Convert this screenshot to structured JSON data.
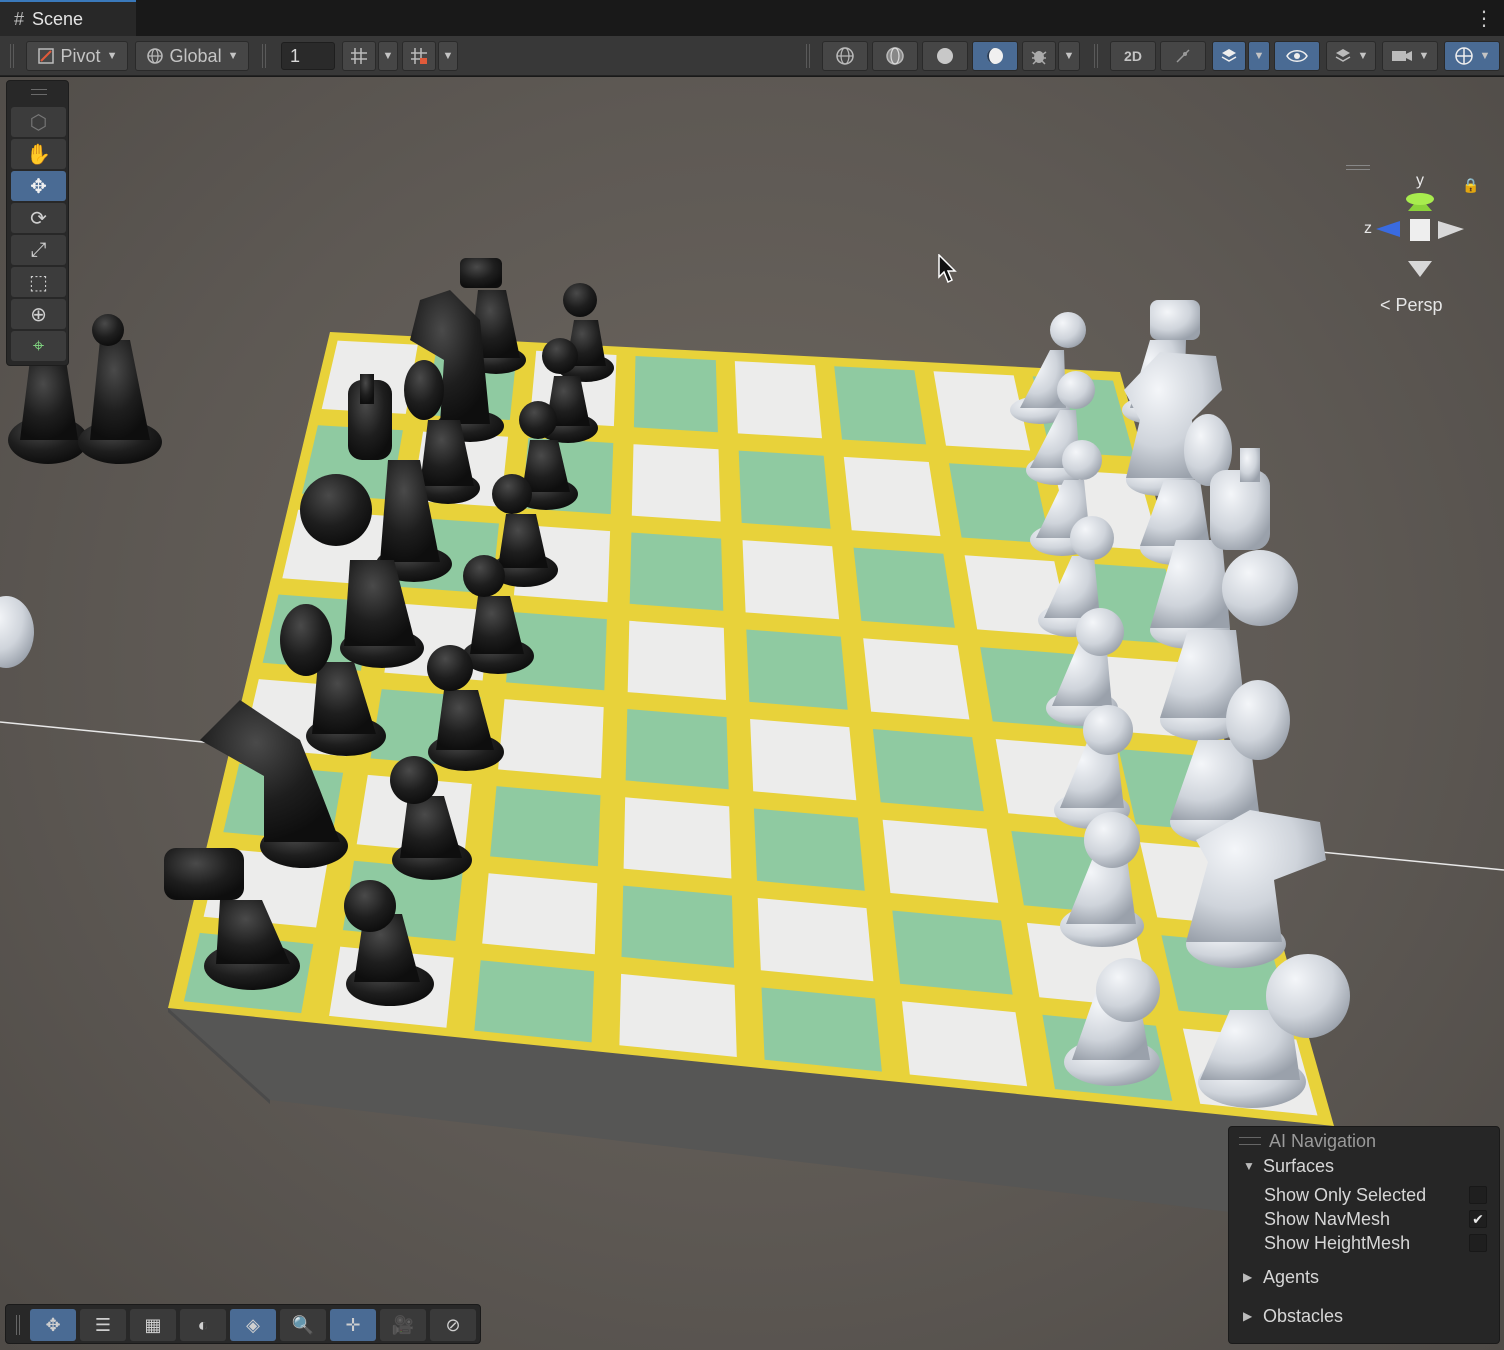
{
  "tab": {
    "icon": "scene-hash-icon",
    "title": "Scene",
    "menu": "⋮"
  },
  "toolbar": {
    "pivot_label": "Pivot",
    "global_label": "Global",
    "grid_value": "1"
  },
  "gizmo": {
    "y": "y",
    "z": "z",
    "persp_label": "Persp"
  },
  "tools": [
    "view-cube-icon",
    "hand-icon",
    "move-icon",
    "rotate-icon",
    "scale-icon",
    "rect-icon",
    "transform-icon",
    "custom-tool-icon"
  ],
  "overlay": {
    "title": "AI Navigation",
    "surfaces_label": "Surfaces",
    "items": [
      {
        "label": "Show Only Selected",
        "checked": false
      },
      {
        "label": "Show NavMesh",
        "checked": true
      },
      {
        "label": "Show HeightMesh",
        "checked": false
      }
    ],
    "agents_label": "Agents",
    "obstacles_label": "Obstacles"
  },
  "colors": {
    "accent": "#4a6b94",
    "board_green": "#8fcaa1",
    "board_white": "#ececeb",
    "board_yellow": "#e8d23a",
    "black_piece": "#1c1c1c",
    "white_piece": "#d8dce2"
  }
}
